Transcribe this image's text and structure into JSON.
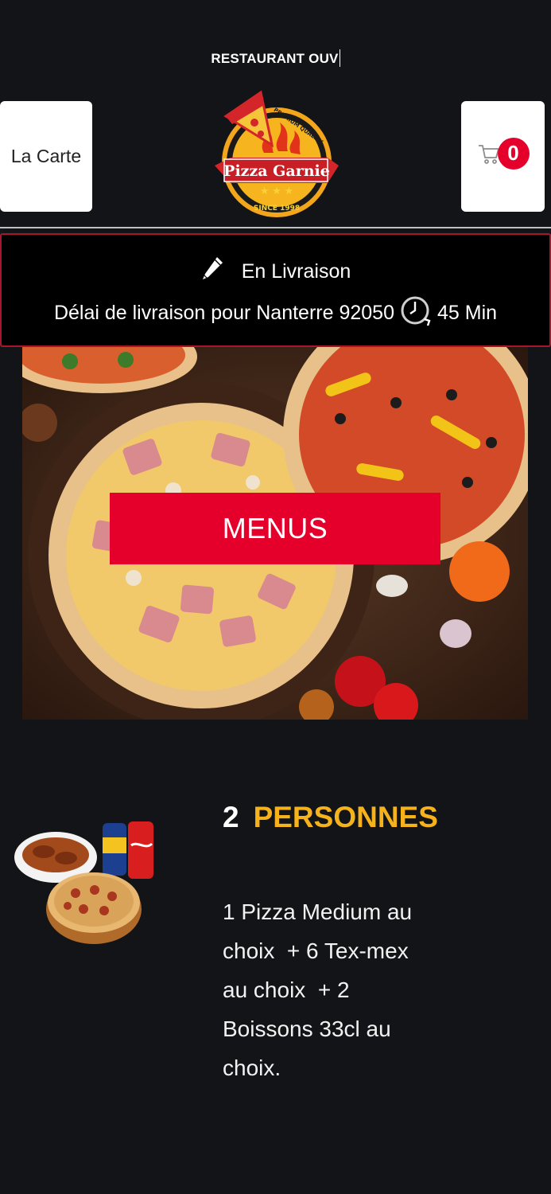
{
  "header": {
    "marquee_text": "RESTAURANT OUV",
    "menu_button_label": "La Carte",
    "logo": {
      "name": "Pizza Garnie",
      "tagline_top": "PREMIUM QUALITY",
      "tagline_bottom": "SINCE 1998"
    },
    "cart": {
      "icon": "cart-icon",
      "count": "0"
    }
  },
  "delivery": {
    "mode_icon": "pencil-icon",
    "mode_label": "En Livraison",
    "delay_text": "Délai de livraison pour Nanterre 92050",
    "clock_icon": "clock-icon",
    "delay_value": "45 Min"
  },
  "hero": {
    "button_label": "MENUS"
  },
  "combo": {
    "count": "2",
    "title": "PERSONNES",
    "description": "1 Pizza Medium au\nchoix  + 6 Tex-mex\nau choix  + 2\nBoissons 33cl au\nchoix."
  },
  "colors": {
    "accent_red": "#e4002b",
    "title_yellow": "#f5b21b",
    "background": "#131417"
  }
}
